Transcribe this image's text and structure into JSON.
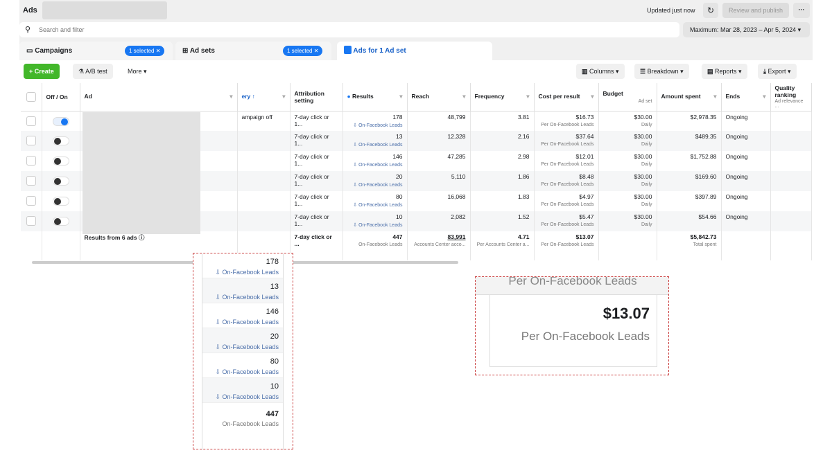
{
  "header": {
    "title": "Ads",
    "updated": "Updated just now",
    "review": "Review and publish",
    "more": "···"
  },
  "search": {
    "placeholder": "Search and filter"
  },
  "date_range": "Maximum: Mar 28, 2023 – Apr 5, 2024",
  "tabs": [
    {
      "label": "Campaigns",
      "badge": "1 selected"
    },
    {
      "label": "Ad sets",
      "badge": "1 selected"
    },
    {
      "label": "Ads for 1 Ad set"
    }
  ],
  "toolbar": {
    "create": "Create",
    "ab_test": "A/B test",
    "more": "More",
    "columns": "Columns",
    "breakdown": "Breakdown",
    "reports": "Reports",
    "export": "Export"
  },
  "columns": {
    "toggle": "Off / On",
    "ad": "Ad",
    "delivery": "ery ↑",
    "attribution": "Attribution setting",
    "results": "Results",
    "reach": "Reach",
    "frequency": "Frequency",
    "cost": "Cost per result",
    "budget": "Budget",
    "budget_sub": "Ad set",
    "amount": "Amount spent",
    "ends": "Ends",
    "quality": "Quality ranking",
    "quality_sub": "Ad relevance ..."
  },
  "rows": [
    {
      "on": true,
      "delivery": "ampaign off",
      "attribution": "7-day click or 1...",
      "results": "178",
      "result_type": "On-Facebook Leads",
      "reach": "48,799",
      "frequency": "3.81",
      "cost": "$16.73",
      "cost_sub": "Per On-Facebook Leads",
      "budget": "$30.00",
      "budget_sub": "Daily",
      "amount": "$2,978.35",
      "ends": "Ongoing"
    },
    {
      "on": false,
      "delivery": "",
      "attribution": "7-day click or 1...",
      "results": "13",
      "result_type": "On-Facebook Leads",
      "reach": "12,328",
      "frequency": "2.16",
      "cost": "$37.64",
      "cost_sub": "Per On-Facebook Leads",
      "budget": "$30.00",
      "budget_sub": "Daily",
      "amount": "$489.35",
      "ends": "Ongoing"
    },
    {
      "on": false,
      "delivery": "",
      "attribution": "7-day click or 1...",
      "results": "146",
      "result_type": "On-Facebook Leads",
      "reach": "47,285",
      "frequency": "2.98",
      "cost": "$12.01",
      "cost_sub": "Per On-Facebook Leads",
      "budget": "$30.00",
      "budget_sub": "Daily",
      "amount": "$1,752.88",
      "ends": "Ongoing"
    },
    {
      "on": false,
      "delivery": "",
      "attribution": "7-day click or 1...",
      "results": "20",
      "result_type": "On-Facebook Leads",
      "reach": "5,110",
      "frequency": "1.86",
      "cost": "$8.48",
      "cost_sub": "Per On-Facebook Leads",
      "budget": "$30.00",
      "budget_sub": "Daily",
      "amount": "$169.60",
      "ends": "Ongoing"
    },
    {
      "on": false,
      "delivery": "",
      "attribution": "7-day click or 1...",
      "results": "80",
      "result_type": "On-Facebook Leads",
      "reach": "16,068",
      "frequency": "1.83",
      "cost": "$4.97",
      "cost_sub": "Per On-Facebook Leads",
      "budget": "$30.00",
      "budget_sub": "Daily",
      "amount": "$397.89",
      "ends": "Ongoing"
    },
    {
      "on": false,
      "delivery": "",
      "attribution": "7-day click or 1...",
      "results": "10",
      "result_type": "On-Facebook Leads",
      "reach": "2,082",
      "frequency": "1.52",
      "cost": "$5.47",
      "cost_sub": "Per On-Facebook Leads",
      "budget": "$30.00",
      "budget_sub": "Daily",
      "amount": "$54.66",
      "ends": "Ongoing"
    }
  ],
  "total": {
    "label": "Results from 6 ads",
    "attribution": "7-day click or ...",
    "results": "447",
    "result_type": "On-Facebook Leads",
    "reach": "83,991",
    "reach_sub": "Accounts Center acco...",
    "frequency": "4.71",
    "frequency_sub": "Per Accounts Center a...",
    "cost": "$13.07",
    "cost_sub": "Per On-Facebook Leads",
    "amount": "$5,842.73",
    "amount_sub": "Total spent"
  },
  "zoom_results": {
    "values": [
      "178",
      "13",
      "146",
      "20",
      "80",
      "10"
    ],
    "label": "On-Facebook Leads",
    "total": "447",
    "total_label": "On-Facebook Leads"
  },
  "zoom_cost": {
    "header": "Per On-Facebook Leads",
    "value": "$13.07",
    "label": "Per On-Facebook Leads"
  }
}
